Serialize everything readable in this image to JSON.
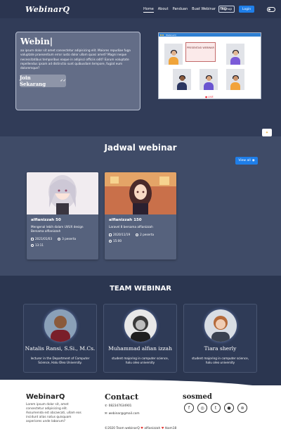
{
  "nav": {
    "logo": "WebinarQ",
    "items": [
      "Home",
      "About",
      "Panduan",
      "Buat Webinar",
      "FAQ"
    ],
    "signup": "Signup",
    "login": "Login"
  },
  "hero": {
    "title": "Webin|",
    "text": "aa ipsum dolor sit amet consectetur adipisicing elit. Maiores repudiae fuga voluptate praesentium error iusto dolor ullam quasi amet? Magni neque necessitatibus temporibus eaque in adipisci officiis odit? Earum voluptate repellendus ipsam ad distinctio sunt quibusdam tempore, fugiat eum doloremque?",
    "join_button": "Join Sekarang",
    "window_title": "WebinarQ",
    "board_text": "PRESENTASI WEBINAR",
    "live_label": "LIVE"
  },
  "jadwal": {
    "title": "Jadwal webinar",
    "view_all": "View all",
    "cards": [
      {
        "host": "alfianizzah 50",
        "desc": "Mengenal lebih dalam UI/UX design Bersama alfianizzah",
        "date": "2021/01/03",
        "peserta": "3 peserta",
        "time": "13:11"
      },
      {
        "host": "alfianizzah 150",
        "desc": "Laravel 8 bersama alfianizzah",
        "date": "2020/11/19",
        "peserta": "2 peserta",
        "time": "15:00"
      }
    ]
  },
  "team": {
    "title": "TEAM WEBINAR",
    "members": [
      {
        "name": "Natalis Ransi, S.Si., M.Cs.",
        "desc": "lecturer in the Department of Computer Science, Halu Oleo University."
      },
      {
        "name": "Muhammad alfian izzah",
        "desc": "student majoring in computer science, halu oleo university"
      },
      {
        "name": "Tiara sherly",
        "desc": "student majoring in computer science, halu oleo university"
      }
    ]
  },
  "footer": {
    "brand": "WebinarQ",
    "text": "Lorem ipsum dolor sit, amet consectetur adipisicing elit. Assumenda est obcaecati, ullam eos incidunt alias natus quisquam asperiores unde laborum?",
    "contact_title": "Contact",
    "phone": "082347634901",
    "email": "webinar@gmail.com",
    "sosmed_title": "sosmed",
    "copyright_a": "©2020 Team webinarQ",
    "copyright_b": "alfianizzah",
    "copyright_c": "tkom18"
  },
  "colors": {
    "accent": "#1f7ee8",
    "bg": "#2f3a55"
  }
}
